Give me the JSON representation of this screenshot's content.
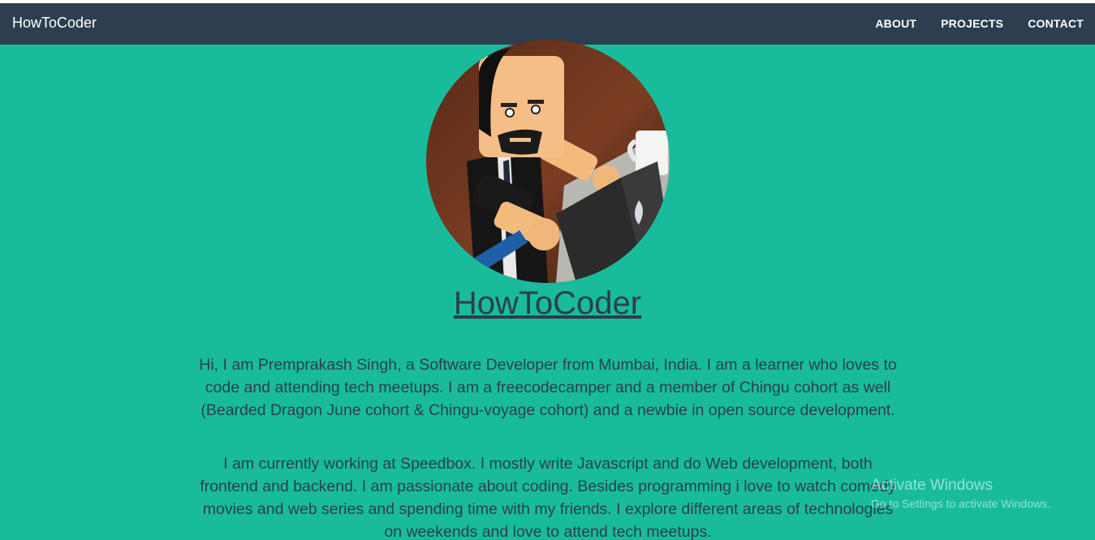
{
  "navbar": {
    "brand": "HowToCoder",
    "links": [
      "ABOUT",
      "PROJECTS",
      "CONTACT"
    ]
  },
  "hero": {
    "title": "HowToCoder",
    "paragraphs": [
      "Hi, I am Premprakash Singh, a Software Developer from Mumbai, India. I am a learner who loves to code and attending tech meetups. I am a freecodecamper and a member of Chingu cohort as well (Bearded Dragon June cohort & Chingu-voyage cohort) and a newbie in open source development.",
      "I am currently working at Speedbox. I mostly write Javascript and do Web development, both frontend and backend. I am passionate about coding. Besides programming i love to watch comedy movies and web series and spending time with my friends. I explore different areas of technologies on weekends and love to attend tech meetups."
    ]
  },
  "watermark": {
    "title": "Activate Windows",
    "subtitle": "Go to Settings to activate Windows."
  },
  "colors": {
    "background": "#18bc9c",
    "navbar": "#2c3e50",
    "text": "#2c3e50"
  }
}
